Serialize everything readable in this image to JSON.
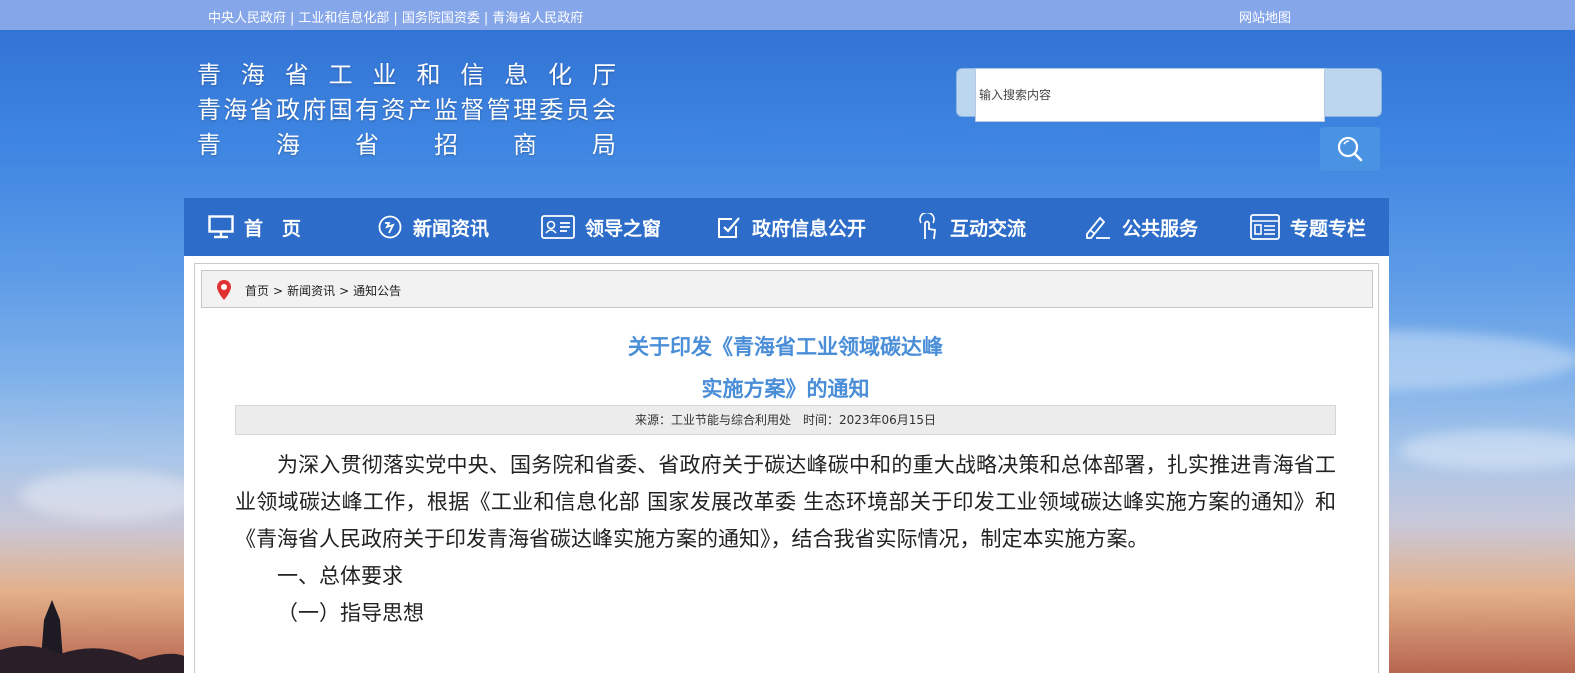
{
  "topbar": {
    "links": [
      "中央人民政府",
      "工业和信息化部",
      "国务院国资委",
      "青海省人民政府"
    ],
    "sitemap": "网站地图"
  },
  "header": {
    "title_lines": [
      "青海省工业和信息化厅",
      "青海省政府国有资产监督管理委员会",
      "青海省招商局"
    ]
  },
  "search": {
    "placeholder": "输入搜索内容"
  },
  "nav": {
    "items": [
      {
        "label": "首　页",
        "icon": "monitor-icon"
      },
      {
        "label": "新闻资讯",
        "icon": "news-icon"
      },
      {
        "label": "领导之窗",
        "icon": "id-card-icon"
      },
      {
        "label": "政府信息公开",
        "icon": "checkbox-icon"
      },
      {
        "label": "互动交流",
        "icon": "touch-icon"
      },
      {
        "label": "公共服务",
        "icon": "edit-icon"
      },
      {
        "label": "专题专栏",
        "icon": "column-icon"
      }
    ]
  },
  "breadcrumb": [
    "首页",
    "新闻资讯",
    "通知公告"
  ],
  "article": {
    "title_line1": "关于印发《青海省工业领域碳达峰",
    "title_line2": "实施方案》的通知",
    "meta": "来源：工业节能与综合利用处　时间：2023年06月15日",
    "paragraphs": [
      "为深入贯彻落实党中央、国务院和省委、省政府关于碳达峰碳中和的重大战略决策和总体部署，扎实推进青海省工业领域碳达峰工作，根据《工业和信息化部 国家发展改革委 生态环境部关于印发工业领域碳达峰实施方案的通知》和《青海省人民政府关于印发青海省碳达峰实施方案的通知》，结合我省实际情况，制定本实施方案。",
      "一、总体要求",
      "（一）指导思想"
    ]
  },
  "colors": {
    "topbar": "#86a6ea",
    "nav": "#2d6dc9",
    "title_blue": "#4a8ed8",
    "search_button": "#4a93e3"
  }
}
